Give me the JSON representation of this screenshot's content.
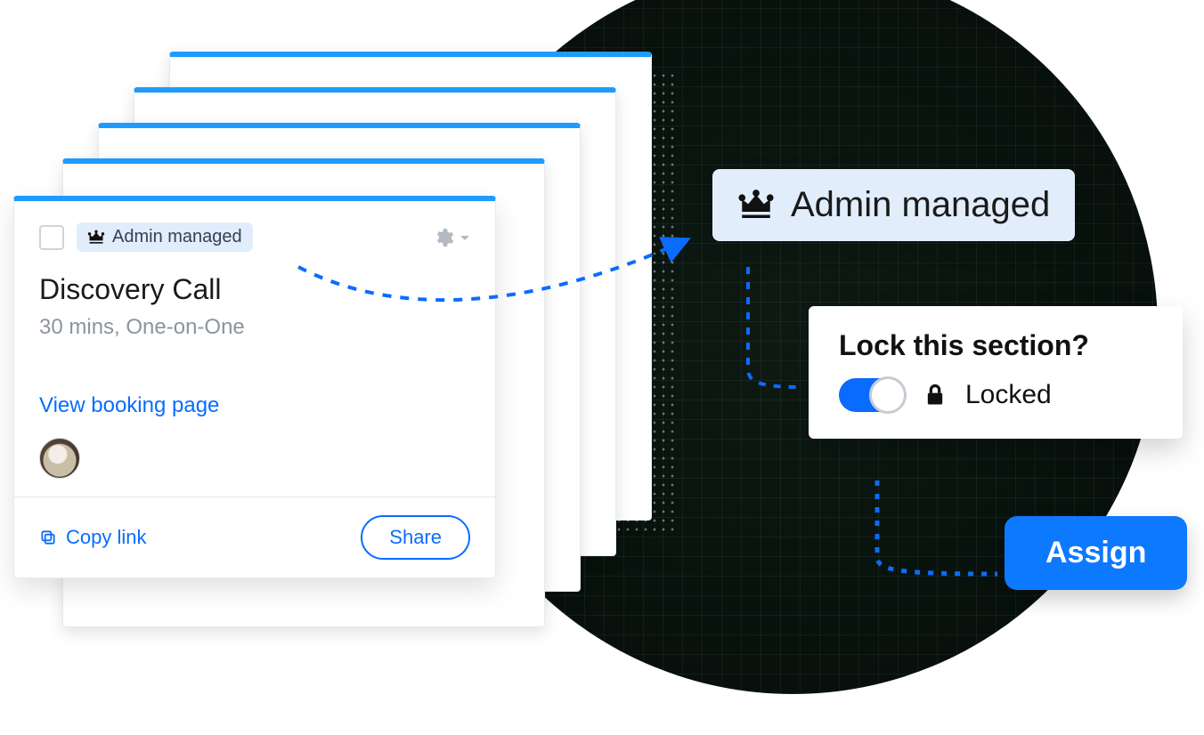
{
  "card": {
    "badge_label": "Admin managed",
    "title": "Discovery Call",
    "subtitle": "30 mins, One-on-One",
    "view_link": "View booking page",
    "copy_link": "Copy link",
    "share": "Share"
  },
  "popovers": {
    "admin_label": "Admin managed",
    "lock_question": "Lock this section?",
    "locked_label": "Locked",
    "toggle_on": true,
    "assign": "Assign"
  },
  "colors": {
    "accent": "#0A6CFF",
    "badge_bg": "#E2EDFC"
  }
}
